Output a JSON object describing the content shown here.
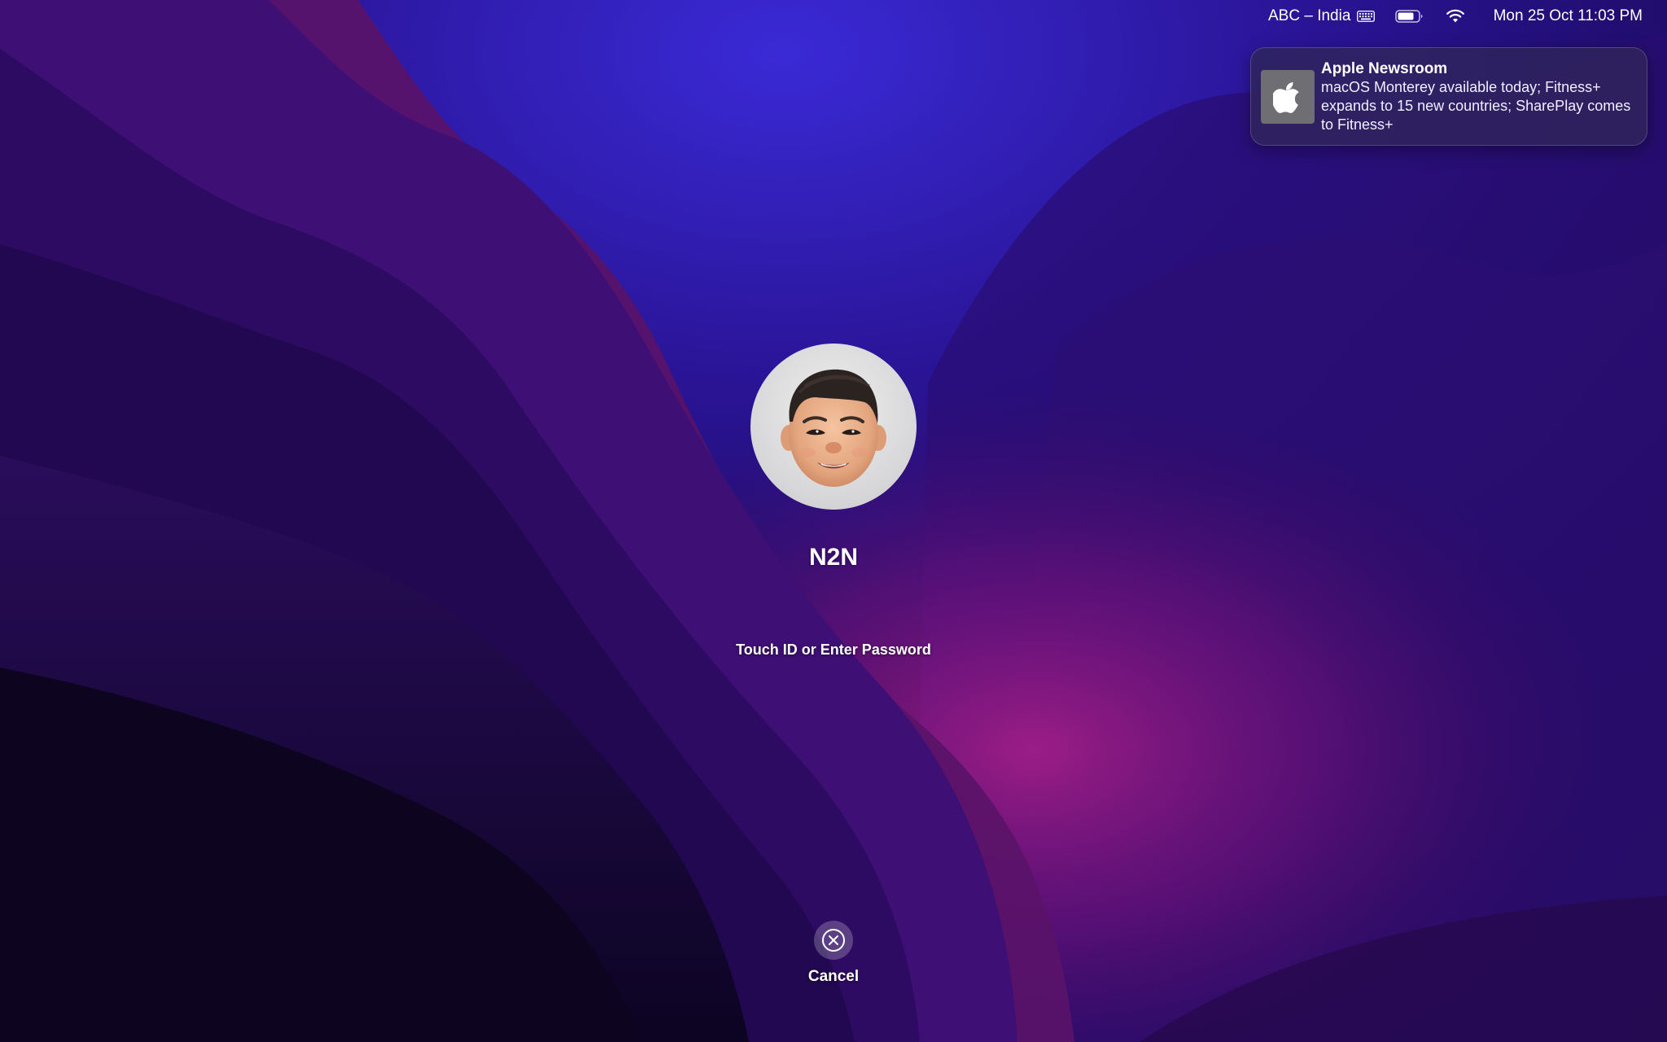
{
  "menubar": {
    "input_source": "ABC – India",
    "input_icon": "keyboard-icon",
    "battery_icon": "battery-icon",
    "wifi_icon": "wifi-icon",
    "clock": "Mon 25 Oct  11:03 PM"
  },
  "notification": {
    "app_icon": "apple-logo-icon",
    "title": "Apple Newsroom",
    "body": "macOS Monterey available today; Fitness+ expands to 15 new countries; SharePlay comes to Fitness+"
  },
  "login": {
    "avatar": "memoji-avatar",
    "user_name": "N2N",
    "prompt": "Touch ID or Enter Password",
    "cancel_icon": "close-circle-icon",
    "cancel_label": "Cancel"
  }
}
